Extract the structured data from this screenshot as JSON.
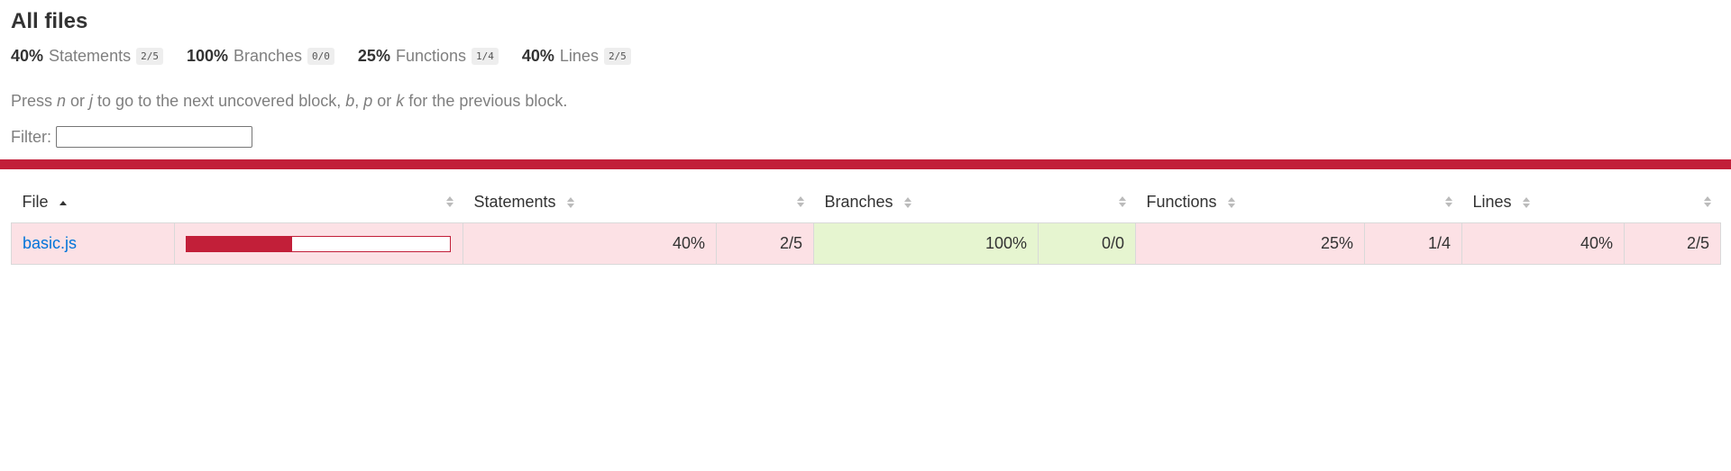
{
  "page": {
    "title": "All files",
    "summary": [
      {
        "pct": "40%",
        "label": "Statements",
        "fraction": "2/5"
      },
      {
        "pct": "100%",
        "label": "Branches",
        "fraction": "0/0"
      },
      {
        "pct": "25%",
        "label": "Functions",
        "fraction": "1/4"
      },
      {
        "pct": "40%",
        "label": "Lines",
        "fraction": "2/5"
      }
    ],
    "help": {
      "t1": "Press ",
      "n": "n",
      "t2": " or ",
      "j": "j",
      "t3": " to go to the next uncovered block, ",
      "b": "b",
      "t4": ", ",
      "p": "p",
      "t5": " or ",
      "k": "k",
      "t6": " for the previous block."
    },
    "filter_label": "Filter:",
    "filter_value": ""
  },
  "table": {
    "headers": {
      "file": "File",
      "statements": "Statements",
      "branches": "Branches",
      "functions": "Functions",
      "lines": "Lines"
    },
    "rows": [
      {
        "file": "basic.js",
        "coverage_fraction": 0.4,
        "statements_pct": "40%",
        "statements_frac": "2/5",
        "branches_pct": "100%",
        "branches_frac": "0/0",
        "functions_pct": "25%",
        "functions_frac": "1/4",
        "lines_pct": "40%",
        "lines_frac": "2/5"
      }
    ]
  },
  "colors": {
    "low": "#fce1e5",
    "high": "#e6f5d0",
    "accent": "#c21f39",
    "link": "#0074d9"
  }
}
